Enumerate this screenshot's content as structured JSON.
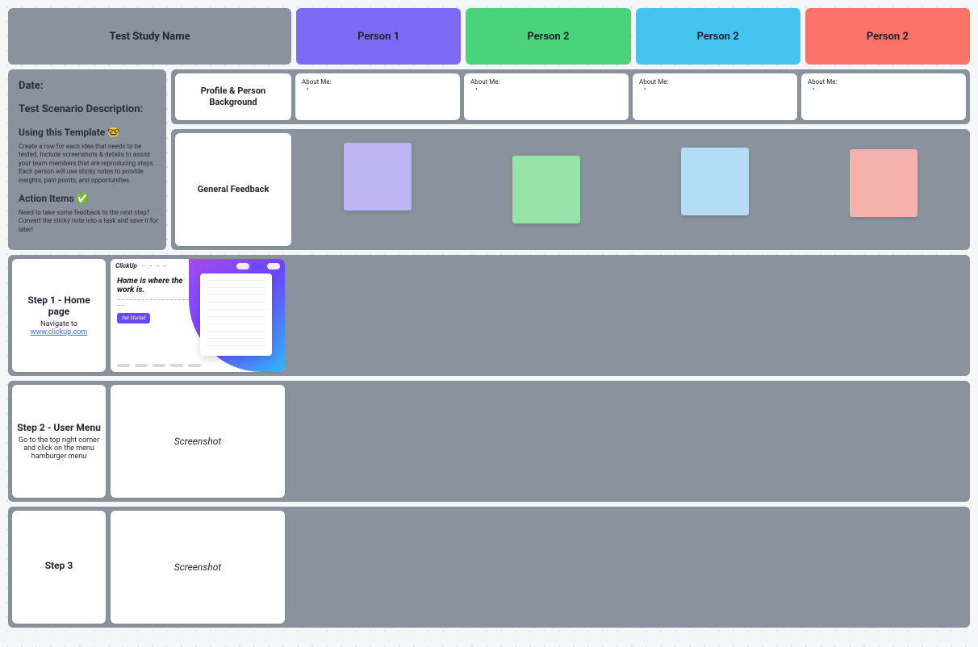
{
  "header": {
    "study": "Test Study Name",
    "persons": [
      "Person 1",
      "Person 2",
      "Person 2",
      "Person 2"
    ]
  },
  "side": {
    "date_label": "Date:",
    "scenario_label": "Test Scenario Description:",
    "template_heading": "Using this Template 🤓",
    "template_desc": "Create a row for each idea that needs to be tested. Include screenshots & details to assist your team members that are reproducing steps. Each person will use sticky notes to provide insights, pain points, and opportunities.",
    "actions_heading": "Action Items ✅",
    "actions_desc": "Need to take some feedback to the next step? Convert the sticky note into a task and save it for later!"
  },
  "profile": {
    "label": "Profile & Person Background",
    "about_label": "About Me:"
  },
  "feedback": {
    "label": "General Feedback"
  },
  "steps": [
    {
      "title": "Step 1 - Home page",
      "desc_prefix": "Navigate to ",
      "link": "www.clickup.com",
      "screenshot_kind": "clickup"
    },
    {
      "title": "Step 2 - User Menu",
      "desc": "Go to the top right corner and click on the menu hamburger menu",
      "screenshot_kind": "placeholder",
      "placeholder_text": "Screenshot"
    },
    {
      "title": "Step 3",
      "desc": "",
      "screenshot_kind": "placeholder",
      "placeholder_text": "Screenshot"
    }
  ],
  "mock": {
    "logo": "ClickUp",
    "headline": "Home is where the work is."
  }
}
